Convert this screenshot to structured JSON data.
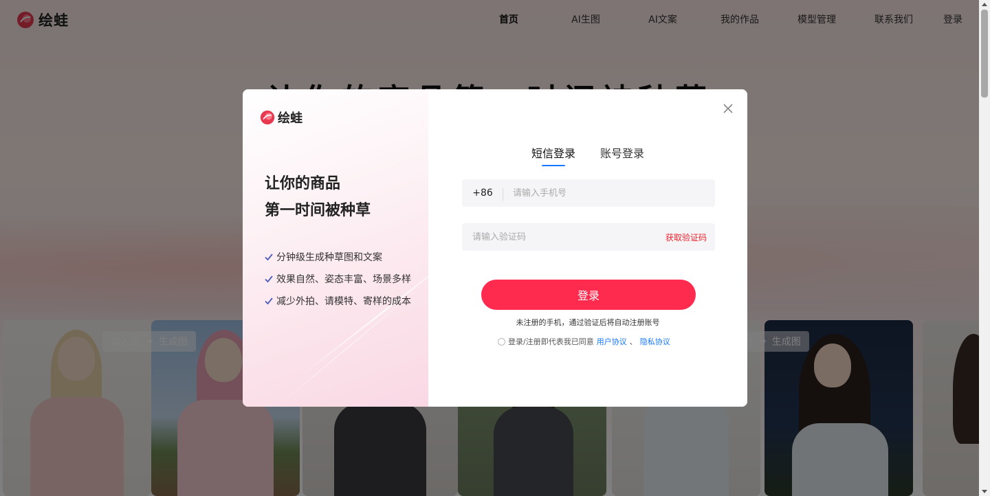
{
  "site": {
    "brand_name": "绘蛙",
    "nav": [
      {
        "label": "首页",
        "active": true
      },
      {
        "label": "AI生图"
      },
      {
        "label": "AI文案"
      },
      {
        "label": "我的作品"
      },
      {
        "label": "模型管理"
      },
      {
        "label": "联系我们"
      },
      {
        "label": "登录"
      }
    ],
    "hero_title": "让你的商品第一时间被种草",
    "gallery_labels": [
      {
        "input": "输入图",
        "output": "生成图"
      },
      {
        "input": "输入图",
        "output": "生成图"
      }
    ]
  },
  "modal": {
    "brand_name": "绘蛙",
    "slogan_line1": "让你的商品",
    "slogan_line2": "第一时间被种草",
    "features": [
      "分钟级生成种草图和文案",
      "效果自然、姿态丰富、场景多样",
      "减少外拍、请模特、寄样的成本"
    ],
    "tabs": [
      {
        "label": "短信登录",
        "active": true
      },
      {
        "label": "账号登录",
        "active": false
      }
    ],
    "country_code": "+86",
    "phone_placeholder": "请输入手机号",
    "code_placeholder": "请输入验证码",
    "get_code_label": "获取验证码",
    "login_button": "登录",
    "hint": "未注册的手机，通过验证后将自动注册账号",
    "agree_prefix": "登录/注册即代表我已同意",
    "user_agreement": "用户协议",
    "separator": "、",
    "privacy_agreement": "隐私协议"
  },
  "colors": {
    "accent": "#ff2b4f",
    "link": "#1677ff",
    "danger": "#f5222d"
  },
  "icons": [
    "logo-icon",
    "check-icon",
    "close-icon",
    "arrow-right-icon"
  ]
}
